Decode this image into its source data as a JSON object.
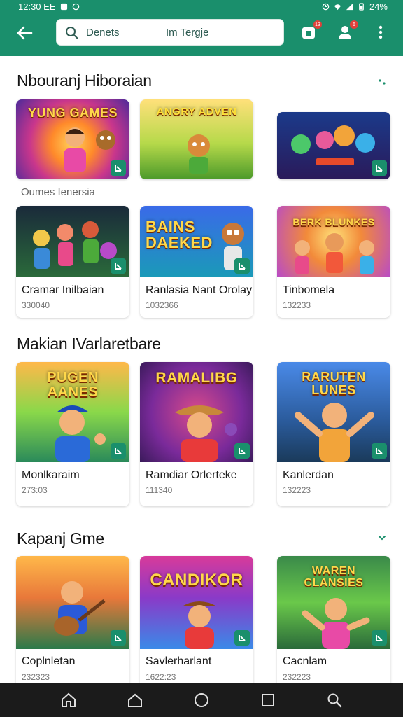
{
  "status_bar": {
    "time": "12:30 EE",
    "battery": "24%"
  },
  "search": {
    "prefix": "Denets",
    "query": "Im Tergje"
  },
  "app_bar": {
    "notification_badge": "13",
    "profile_badge": "6"
  },
  "sections": [
    {
      "title": "Nbouranj Hiboraian",
      "row_caption": "Oumes Ienersia",
      "cards": [
        {
          "thumb_title": "YUNG GAMES",
          "icon": "game-art-icon"
        },
        {
          "thumb_title": "ANGRY ADVEN",
          "icon": "game-art-icon"
        },
        {
          "thumb_title": "",
          "icon": "game-art-icon"
        },
        {
          "thumb_title": "",
          "name": "Cramar Inilbaian",
          "count": "330040",
          "icon": "game-art-icon"
        },
        {
          "thumb_title": "BAINS DAEKED",
          "name": "Ranlasia Nant Orolay",
          "count": "1032366",
          "icon": "game-art-icon"
        },
        {
          "thumb_title": "BERK BLUNKES",
          "name": "Tinbomela",
          "count": "132233",
          "icon": "game-art-icon"
        }
      ]
    },
    {
      "title": "Makian IVarlaretbare",
      "cards": [
        {
          "thumb_title": "PUGEN AANES",
          "name": "Monlkaraim",
          "count": "273:03",
          "icon": "game-art-icon"
        },
        {
          "thumb_title": "RAMALIBG",
          "name": "Ramdiar Orlerteke",
          "count": "111340",
          "icon": "game-art-icon"
        },
        {
          "thumb_title": "RARUTEN LUNES",
          "name": "Kanlerdan",
          "count": "132223",
          "icon": "game-art-icon"
        }
      ]
    },
    {
      "title": "Kapanj Gme",
      "cards": [
        {
          "thumb_title": "",
          "name": "Coplnletan",
          "count": "232323",
          "icon": "game-art-icon"
        },
        {
          "thumb_title": "CANDIKOR",
          "name": "Savlerharlant",
          "count": "1622:23",
          "icon": "game-art-icon"
        },
        {
          "thumb_title": "WAREN CLANSIES",
          "name": "Cacnlam",
          "count": "232223",
          "icon": "game-art-icon"
        }
      ]
    }
  ],
  "colors": {
    "primary": "#1a8f6c",
    "nav_bg": "#1b1b1b",
    "badge": "#e0403a"
  }
}
